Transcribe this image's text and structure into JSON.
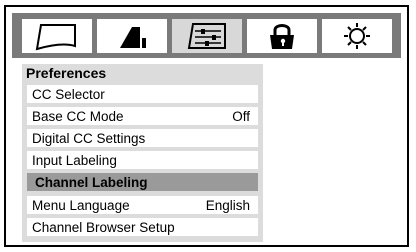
{
  "tabs": [
    {
      "icon": "picture-icon",
      "selected": false
    },
    {
      "icon": "audio-icon",
      "selected": false
    },
    {
      "icon": "preferences-icon",
      "selected": true
    },
    {
      "icon": "lock-icon",
      "selected": false
    },
    {
      "icon": "setup-icon",
      "selected": false
    }
  ],
  "panel": {
    "title": "Preferences",
    "items": [
      {
        "label": "CC Selector",
        "value": ""
      },
      {
        "label": "Base CC Mode",
        "value": "Off"
      },
      {
        "label": "Digital CC Settings",
        "value": ""
      },
      {
        "label": "Input Labeling",
        "value": ""
      },
      {
        "label": "Channel Labeling",
        "value": "",
        "selected": true
      },
      {
        "label": "Menu Language",
        "value": "English"
      },
      {
        "label": "Channel Browser Setup",
        "value": ""
      }
    ]
  },
  "colors": {
    "tabbar": "#7a7a7a",
    "panel": "#dcdcdc",
    "selected_item": "#9a9a9a"
  }
}
